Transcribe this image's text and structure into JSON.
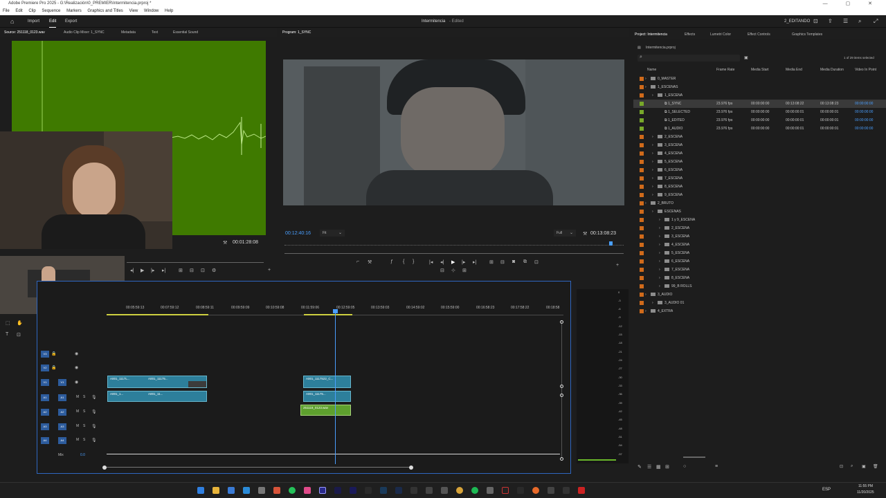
{
  "window": {
    "title": "Adobe Premiere Pro 2025 - G:\\Realización\\0_PREMIER\\Intermitencia.prproj *"
  },
  "menu": {
    "items": [
      "File",
      "Edit",
      "Clip",
      "Sequence",
      "Markers",
      "Graphics and Titles",
      "View",
      "Window",
      "Help"
    ]
  },
  "header": {
    "import": "Import",
    "edit": "Edit",
    "export": "Export",
    "project_title": "Intermitencia",
    "status": "- Edited",
    "workspace": "2_EDITANDO"
  },
  "source_panel": {
    "tabs": [
      "Source: 251118_0123.wav",
      "Audio Clip Mixer: 1_SYNC",
      "Metadata",
      "Text",
      "Essential Sound"
    ],
    "timecode": "00:01:28:08"
  },
  "program_panel": {
    "tab": "Program: 1_SYNC",
    "timecode_current": "00:12:40:16",
    "fit": "Fit",
    "quality": "Full",
    "timecode_total": "00:13:08:23"
  },
  "timeline": {
    "ruler": [
      "00:05:59:13",
      "00:07:59:12",
      "00:08:59:11",
      "00:09:59:09",
      "00:10:59:08",
      "00:11:59:06",
      "00:12:59:05",
      "00:13:59:03",
      "00:14:59:02",
      "00:15:59:00",
      "00:16:58:23",
      "00:17:58:22",
      "00:18:58"
    ],
    "video_tracks": [
      "V3",
      "V2",
      "V1"
    ],
    "audio_tracks": [
      "A1",
      "A2",
      "A3",
      "A4"
    ],
    "mix_label": "Mix",
    "mix_value": "0.0",
    "clips": {
      "v1_a": "A001_1117L...",
      "v1_b": "A001_11175...",
      "v1_c": "A001_1117522_C...",
      "a1_a": "A001_1...",
      "a1_b": "A001_11...",
      "a1_c": "A001_11175...",
      "a2_c": "251118_0123.wav"
    },
    "meter_scale": [
      "0",
      "-3",
      "-6",
      "-9",
      "-12",
      "-15",
      "-18",
      "-21",
      "-24",
      "-27",
      "-30",
      "-33",
      "-36",
      "-39",
      "-42",
      "-45",
      "-48",
      "-51",
      "-54",
      "-57"
    ]
  },
  "project_panel": {
    "tabs": [
      "Project: Intermitencia",
      "Effects",
      "Lumetri Color",
      "Effect Controls",
      "Graphics Templates"
    ],
    "file": "Intermitencia.prproj",
    "selection_count": "1 of 29 items selected",
    "columns": [
      "Name",
      "Frame Rate",
      "Media Start",
      "Media End",
      "Media Duration",
      "Video In Point"
    ],
    "rows": [
      {
        "name": "0_MASTER",
        "level": 1,
        "color": "#d06a1a",
        "frame_rate": "",
        "start": "",
        "end": "",
        "duration": "",
        "in": ""
      },
      {
        "name": "1_ESCENAS",
        "level": 1,
        "color": "#d06a1a",
        "frame_rate": "",
        "start": "",
        "end": "",
        "duration": "",
        "in": ""
      },
      {
        "name": "1_ESCENA",
        "level": 2,
        "color": "#d06a1a",
        "frame_rate": "",
        "start": "",
        "end": "",
        "duration": "",
        "in": ""
      },
      {
        "name": "1_SYNC",
        "level": 3,
        "color": "#78a82a",
        "frame_rate": "23.976 fps",
        "start": "00:00:00:00",
        "end": "00:13:08:22",
        "duration": "00:13:08:23",
        "in": "00:00:00:00",
        "selected": true
      },
      {
        "name": "1_SELECTED",
        "level": 3,
        "color": "#78a82a",
        "frame_rate": "23.976 fps",
        "start": "00:00:00:00",
        "end": "00:00:00:01",
        "duration": "00:00:00:01",
        "in": "00:00:00:00"
      },
      {
        "name": "1_EDITED",
        "level": 3,
        "color": "#78a82a",
        "frame_rate": "23.976 fps",
        "start": "00:00:00:00",
        "end": "00:00:00:01",
        "duration": "00:00:00:01",
        "in": "00:00:00:00"
      },
      {
        "name": "1_AUDIO",
        "level": 3,
        "color": "#78a82a",
        "frame_rate": "23.976 fps",
        "start": "00:00:00:00",
        "end": "00:00:00:01",
        "duration": "00:00:00:01",
        "in": "00:00:00:00"
      },
      {
        "name": "2_ESCENA",
        "level": 2,
        "color": "#d06a1a",
        "frame_rate": "",
        "start": "",
        "end": "",
        "duration": "",
        "in": ""
      },
      {
        "name": "3_ESCENA",
        "level": 2,
        "color": "#d06a1a",
        "frame_rate": "",
        "start": "",
        "end": "",
        "duration": "",
        "in": ""
      },
      {
        "name": "4_ESCENA",
        "level": 2,
        "color": "#d06a1a",
        "frame_rate": "",
        "start": "",
        "end": "",
        "duration": "",
        "in": ""
      },
      {
        "name": "5_ESCENA",
        "level": 2,
        "color": "#d06a1a",
        "frame_rate": "",
        "start": "",
        "end": "",
        "duration": "",
        "in": ""
      },
      {
        "name": "6_ESCENA",
        "level": 2,
        "color": "#d06a1a",
        "frame_rate": "",
        "start": "",
        "end": "",
        "duration": "",
        "in": ""
      },
      {
        "name": "7_ESCENA",
        "level": 2,
        "color": "#d06a1a",
        "frame_rate": "",
        "start": "",
        "end": "",
        "duration": "",
        "in": ""
      },
      {
        "name": "8_ESCENA",
        "level": 2,
        "color": "#d06a1a",
        "frame_rate": "",
        "start": "",
        "end": "",
        "duration": "",
        "in": ""
      },
      {
        "name": "9_ESCENA",
        "level": 2,
        "color": "#d06a1a",
        "frame_rate": "",
        "start": "",
        "end": "",
        "duration": "",
        "in": ""
      },
      {
        "name": "2_BRUTO",
        "level": 1,
        "color": "#d06a1a",
        "frame_rate": "",
        "start": "",
        "end": "",
        "duration": "",
        "in": ""
      },
      {
        "name": "ESCENAS",
        "level": 2,
        "color": "#d06a1a",
        "frame_rate": "",
        "start": "",
        "end": "",
        "duration": "",
        "in": ""
      },
      {
        "name": "1 y 9_ESCENA",
        "level": 3,
        "color": "#d06a1a",
        "frame_rate": "",
        "start": "",
        "end": "",
        "duration": "",
        "in": ""
      },
      {
        "name": "2_ESCENA",
        "level": 3,
        "color": "#d06a1a",
        "frame_rate": "",
        "start": "",
        "end": "",
        "duration": "",
        "in": ""
      },
      {
        "name": "3_ESCENA",
        "level": 3,
        "color": "#d06a1a",
        "frame_rate": "",
        "start": "",
        "end": "",
        "duration": "",
        "in": ""
      },
      {
        "name": "4_ESCENA",
        "level": 3,
        "color": "#d06a1a",
        "frame_rate": "",
        "start": "",
        "end": "",
        "duration": "",
        "in": ""
      },
      {
        "name": "5_ESCENA",
        "level": 3,
        "color": "#d06a1a",
        "frame_rate": "",
        "start": "",
        "end": "",
        "duration": "",
        "in": ""
      },
      {
        "name": "6_ESCENA",
        "level": 3,
        "color": "#d06a1a",
        "frame_rate": "",
        "start": "",
        "end": "",
        "duration": "",
        "in": ""
      },
      {
        "name": "7_ESCENA",
        "level": 3,
        "color": "#d06a1a",
        "frame_rate": "",
        "start": "",
        "end": "",
        "duration": "",
        "in": ""
      },
      {
        "name": "8_ESCENA",
        "level": 3,
        "color": "#d06a1a",
        "frame_rate": "",
        "start": "",
        "end": "",
        "duration": "",
        "in": ""
      },
      {
        "name": "99_B ROLLS",
        "level": 3,
        "color": "#d06a1a",
        "frame_rate": "",
        "start": "",
        "end": "",
        "duration": "",
        "in": ""
      },
      {
        "name": "3_AUDIO",
        "level": 1,
        "color": "#d06a1a",
        "frame_rate": "",
        "start": "",
        "end": "",
        "duration": "",
        "in": ""
      },
      {
        "name": "3_AUDIO 01",
        "level": 2,
        "color": "#d06a1a",
        "frame_rate": "",
        "start": "",
        "end": "",
        "duration": "",
        "in": ""
      },
      {
        "name": "4_EXTRA",
        "level": 1,
        "color": "#d06a1a",
        "frame_rate": "",
        "start": "",
        "end": "",
        "duration": "",
        "in": ""
      }
    ]
  },
  "taskbar": {
    "lang": "ESP",
    "time": "11:55 PM",
    "date": "11/20/2025"
  },
  "colors": {
    "accent": "#2f67c2",
    "source_bg": "#3f7a00",
    "selected_row": "#3a3a3a",
    "playhead": "#4a9fff"
  }
}
